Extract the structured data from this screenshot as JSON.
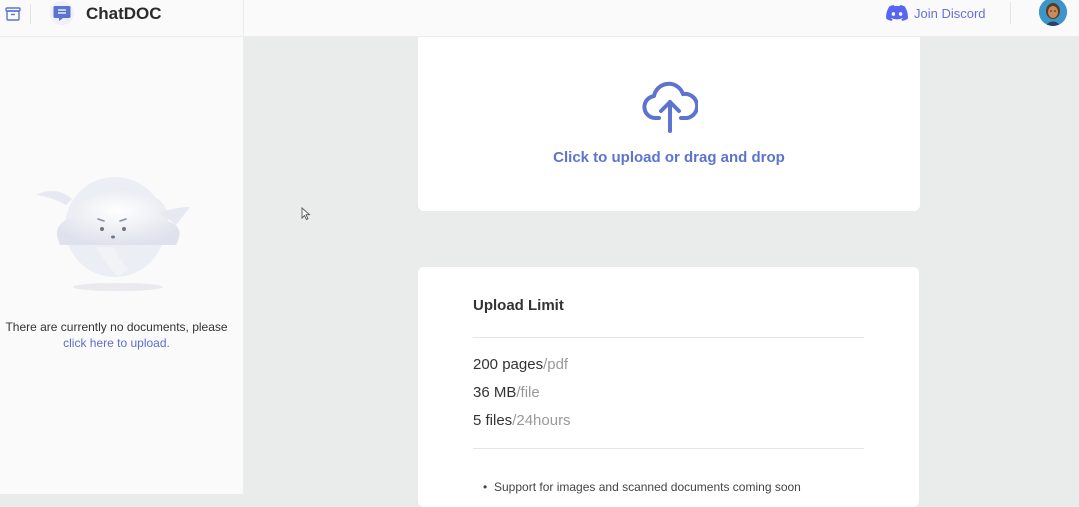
{
  "header": {
    "brand": "ChatDOC",
    "discord_label": "Join Discord",
    "icons": [
      "archive-icon",
      "chatdoc-logo-icon",
      "discord-icon",
      "avatar"
    ]
  },
  "sidebar": {
    "empty_text": "There are currently no documents, please",
    "empty_link": "click here to upload."
  },
  "upload": {
    "label": "Click to upload or drag and drop",
    "icon": "cloud-upload-icon"
  },
  "limits": {
    "title": "Upload Limit",
    "rows": [
      {
        "value": "200 pages",
        "unit": "/pdf"
      },
      {
        "value": "36 MB",
        "unit": "/file"
      },
      {
        "value": "5 files",
        "unit": "/24hours"
      }
    ],
    "note": "Support for images and scanned documents coming soon"
  },
  "colors": {
    "accent": "#5d74cf",
    "discord": "#5865f2",
    "background": "#eaebeb"
  }
}
